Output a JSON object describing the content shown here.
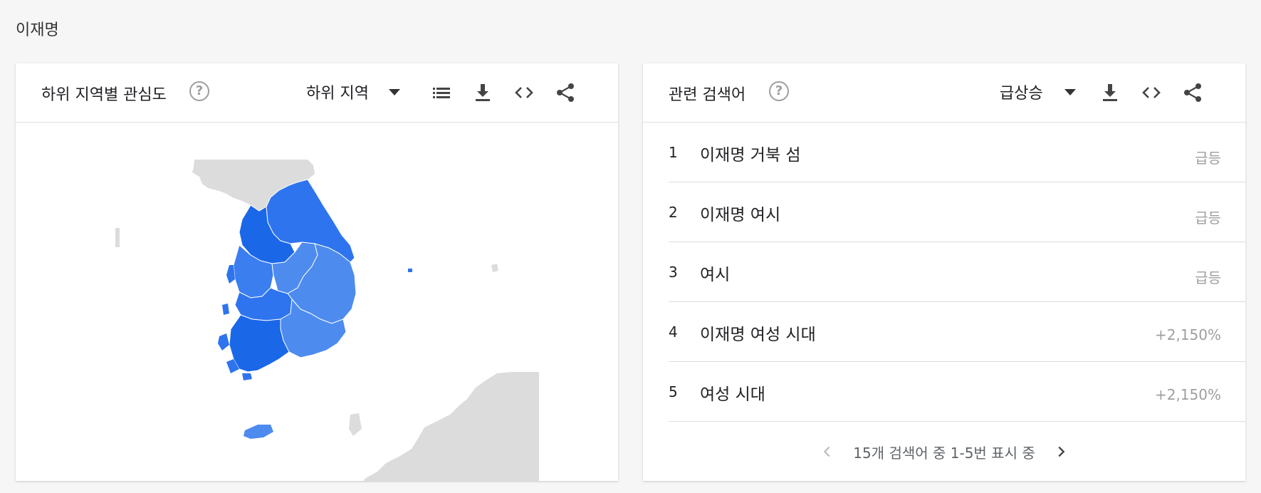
{
  "page": {
    "title": "이재명"
  },
  "map_card": {
    "title": "하위 지역별 관심도",
    "dropdown_label": "하위 지역",
    "icons": [
      "help-icon",
      "caret-down-icon",
      "list-icon",
      "download-icon",
      "embed-code-icon",
      "share-icon"
    ],
    "colors": {
      "region_dark": "#1a67e8",
      "region_mid": "#2e74ee",
      "region_light": "#4d8bef",
      "neighbor_land": "#dcdcdc"
    }
  },
  "related_card": {
    "title": "관련 검색어",
    "dropdown_label": "급상승",
    "icons": [
      "help-icon",
      "caret-down-icon",
      "download-icon",
      "embed-code-icon",
      "share-icon"
    ],
    "rows": [
      {
        "rank": "1",
        "term": "이재명 거북 섬",
        "value": "급등"
      },
      {
        "rank": "2",
        "term": "이재명 여시",
        "value": "급등"
      },
      {
        "rank": "3",
        "term": "여시",
        "value": "급등"
      },
      {
        "rank": "4",
        "term": "이재명 여성 시대",
        "value": "+2,150%"
      },
      {
        "rank": "5",
        "term": "여성 시대",
        "value": "+2,150%"
      }
    ],
    "pagination": {
      "text": "15개 검색어 중 1-5번 표시 중"
    }
  }
}
